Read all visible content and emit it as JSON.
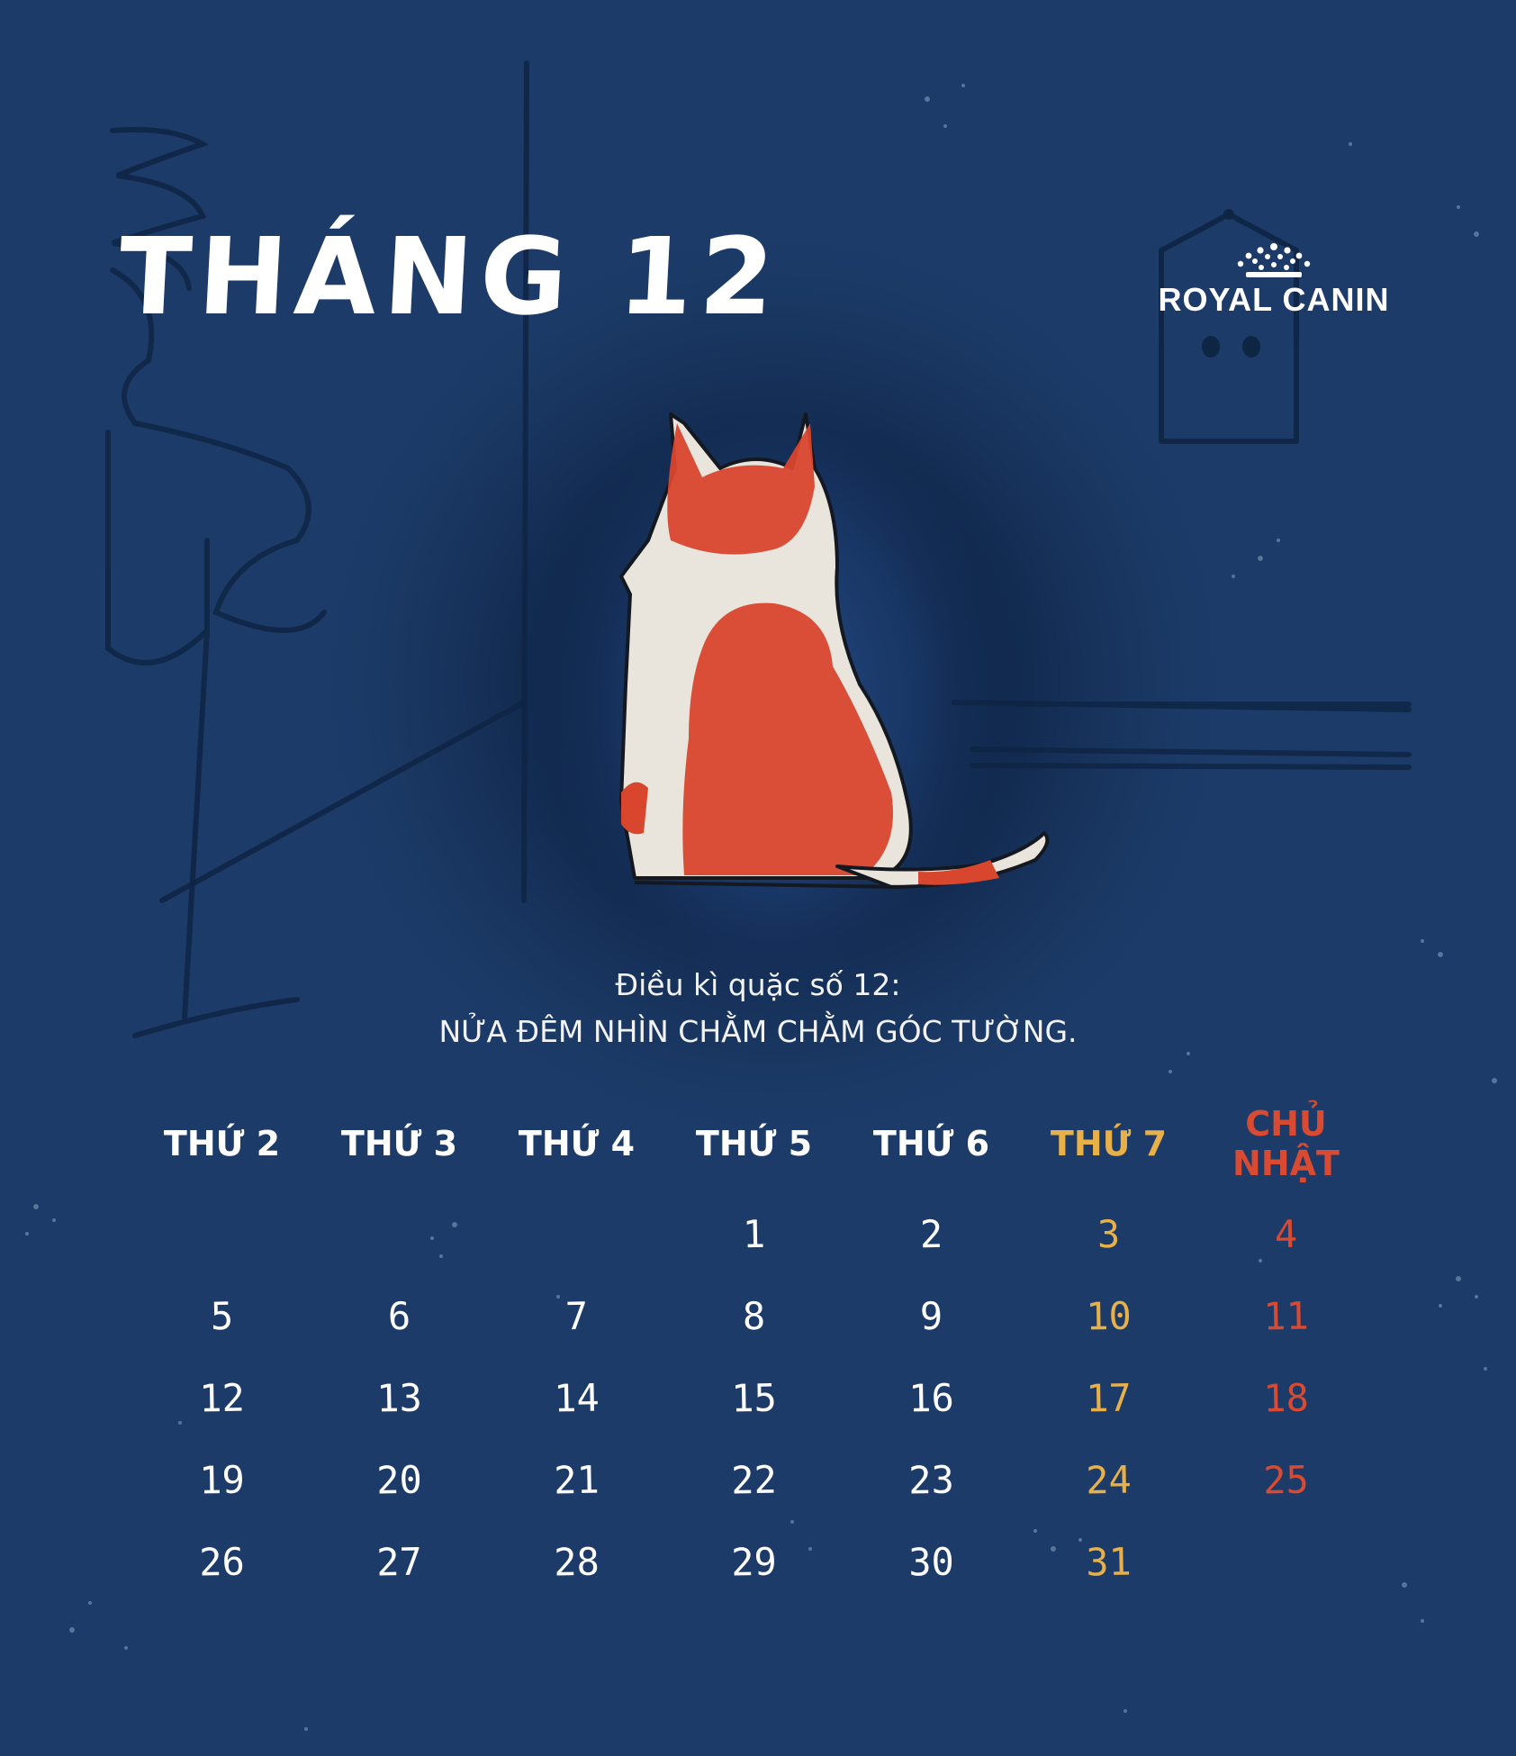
{
  "title": "THÁNG 12",
  "brand": {
    "name": "ROYAL CANIN",
    "icon": "crown-icon"
  },
  "caption": {
    "line1": "Điều kì quặc số 12:",
    "line2": "NỬA ĐÊM NHÌN CHẰM CHẰM GÓC TƯỜNG."
  },
  "colors": {
    "background": "#1c3b68",
    "saturday": "#e7b048",
    "sunday": "#d94a32",
    "cat_orange": "#d9462e"
  },
  "calendar": {
    "weekdays": [
      "THỨ 2",
      "THỨ 3",
      "THỨ 4",
      "THỨ 5",
      "THỨ 6",
      "THỨ 7",
      "CHỦ NHẬT"
    ],
    "weeks": [
      [
        "",
        "",
        "",
        "1",
        "2",
        "3",
        "4"
      ],
      [
        "5",
        "6",
        "7",
        "8",
        "9",
        "10",
        "11"
      ],
      [
        "12",
        "13",
        "14",
        "15",
        "16",
        "17",
        "18"
      ],
      [
        "19",
        "20",
        "21",
        "22",
        "23",
        "24",
        "25"
      ],
      [
        "26",
        "27",
        "28",
        "29",
        "30",
        "31",
        ""
      ]
    ]
  }
}
